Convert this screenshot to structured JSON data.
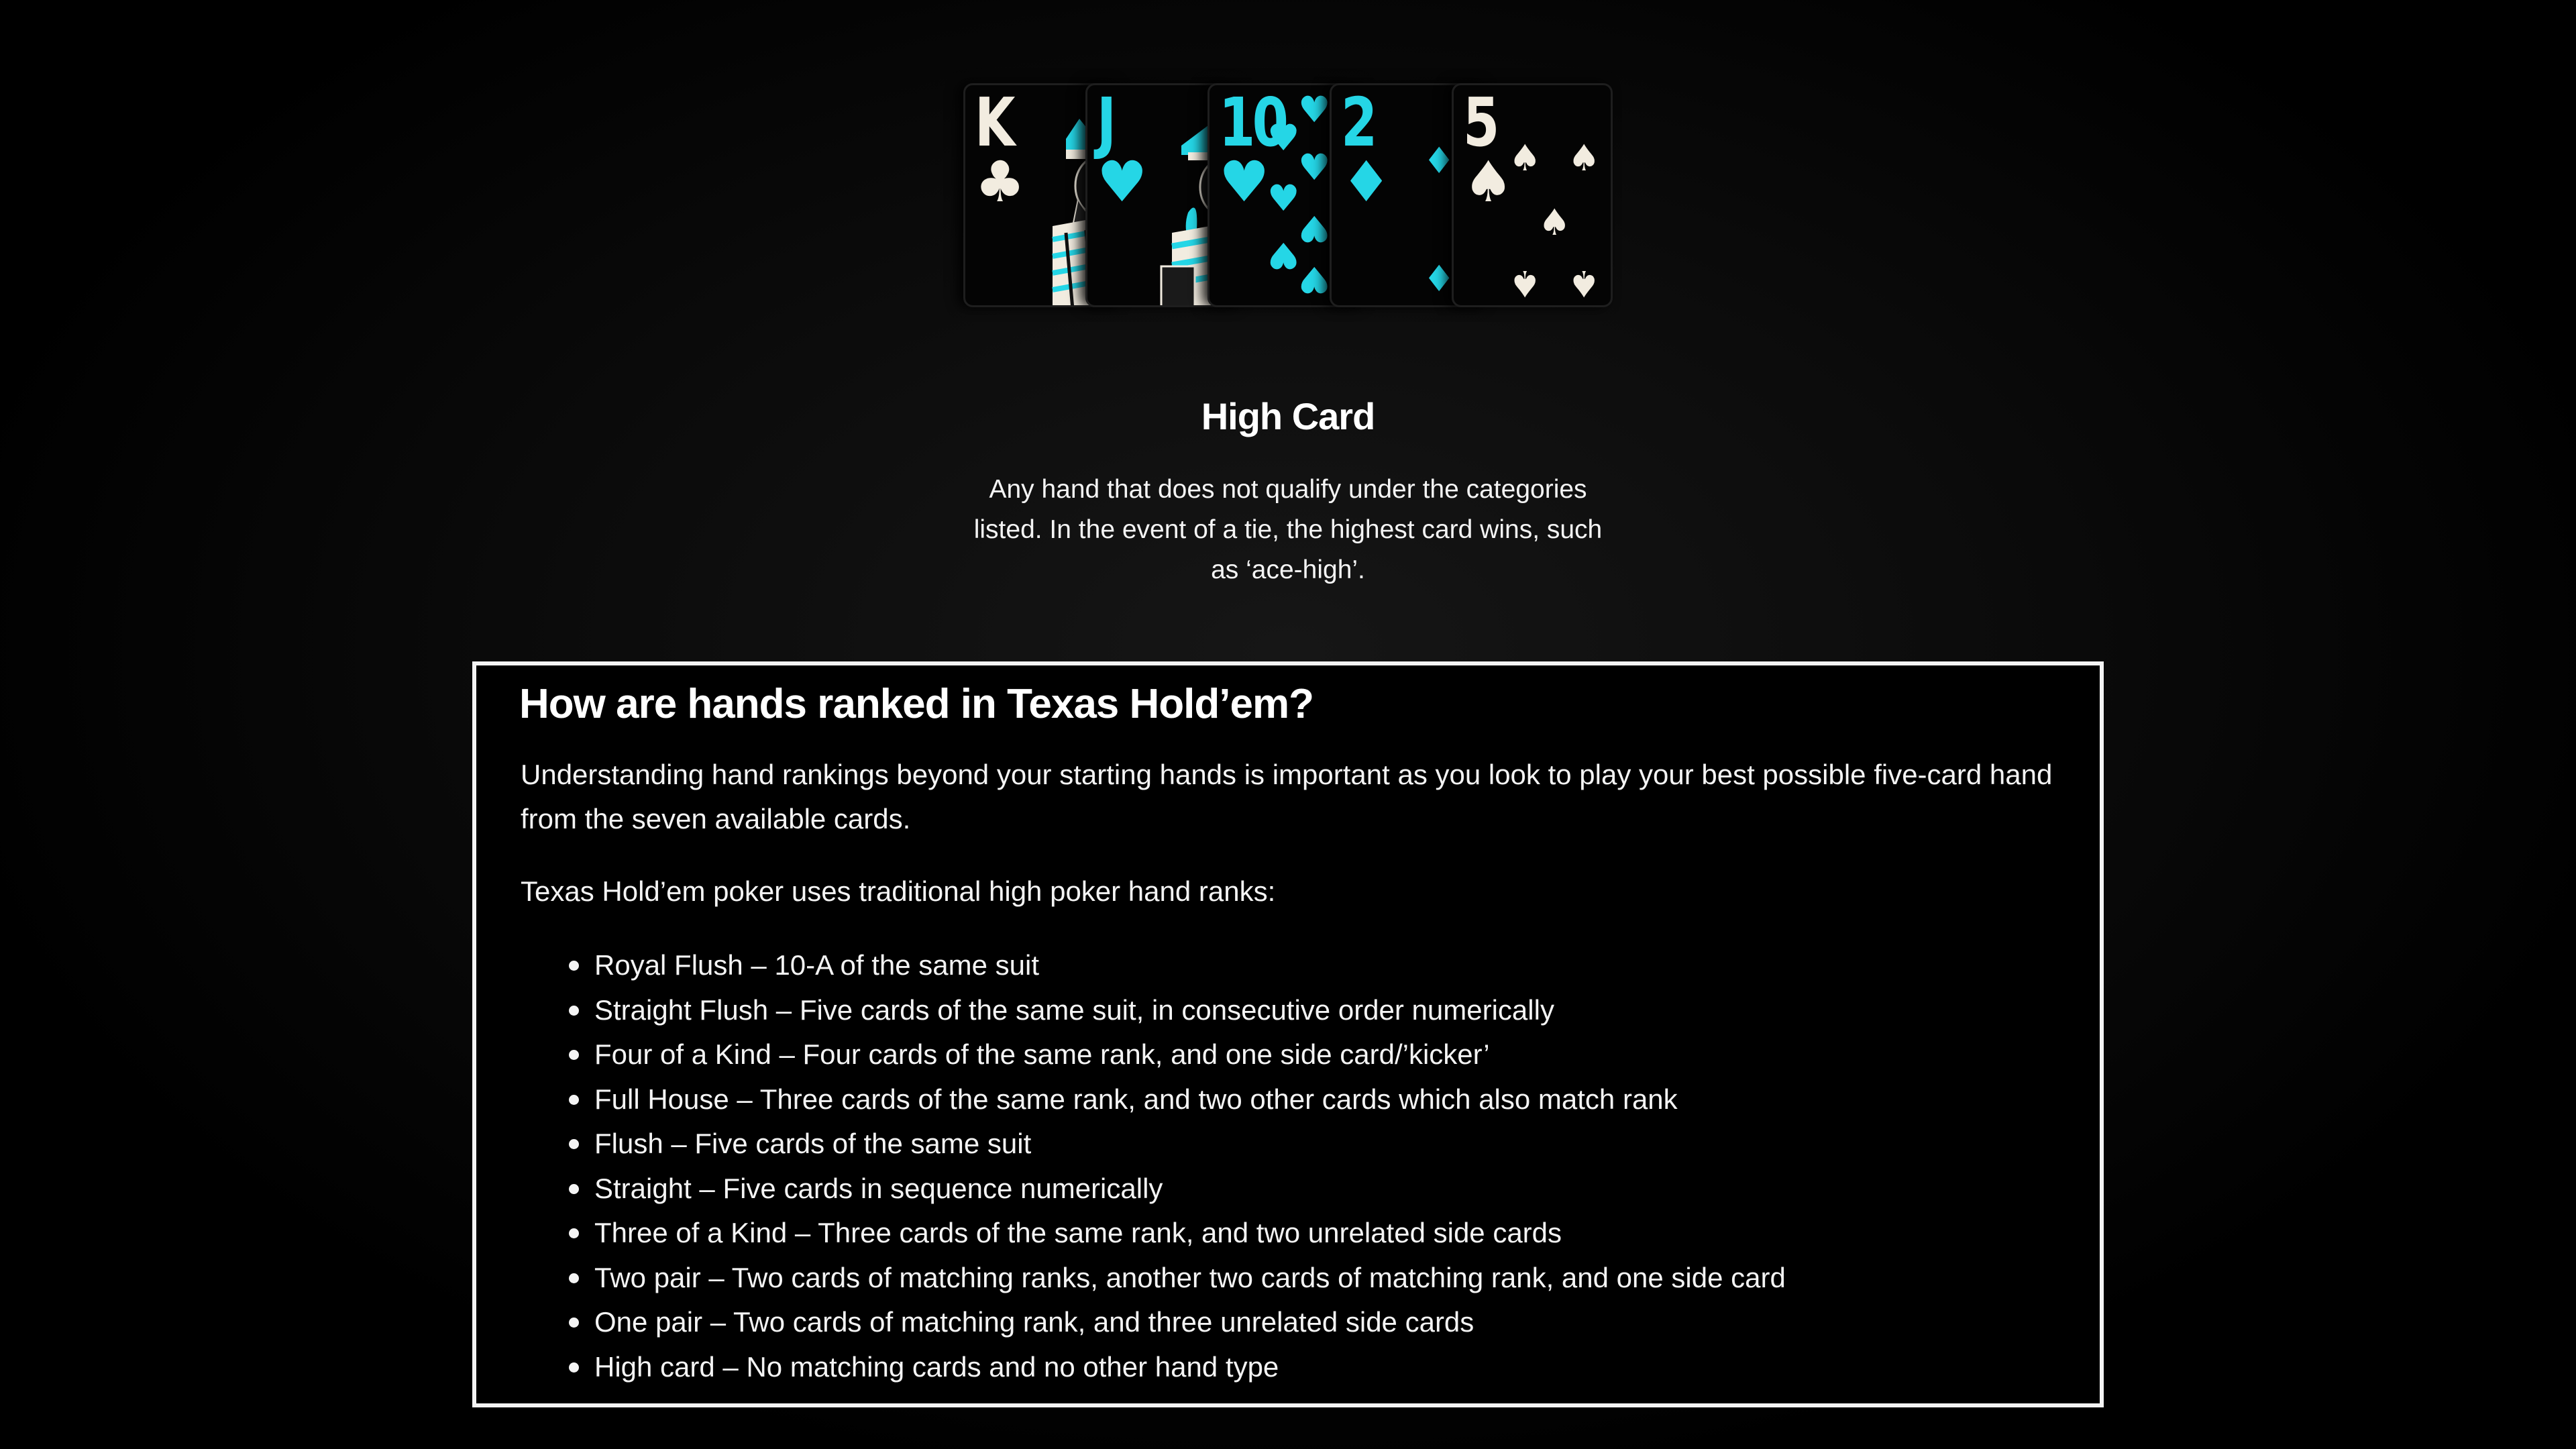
{
  "cards": [
    {
      "rank": "K",
      "suit": "♣",
      "color": "#f2ece0",
      "kind": "face"
    },
    {
      "rank": "J",
      "suit": "♥",
      "color": "#25d6e6",
      "kind": "face"
    },
    {
      "rank": "10",
      "suit": "♥",
      "color": "#25d6e6",
      "kind": "pips"
    },
    {
      "rank": "2",
      "suit": "♦",
      "color": "#25d6e6",
      "kind": "pips"
    },
    {
      "rank": "5",
      "suit": "♠",
      "color": "#f2ece0",
      "kind": "pips"
    }
  ],
  "hand": {
    "title": "High Card",
    "description": "Any hand that does not qualify under the categories listed. In the event of a tie, the highest card wins, such as ‘ace-high’."
  },
  "info": {
    "title": "How are hands ranked in Texas Hold’em?",
    "paragraph1": "Understanding hand rankings beyond your starting hands is important as you look to play your best possible five-card hand from the seven available cards.",
    "paragraph2": "Texas Hold’em poker uses traditional high poker hand ranks:",
    "rankings": [
      "Royal Flush – 10-A of the same suit",
      "Straight Flush – Five cards of the same suit, in consecutive order numerically",
      "Four of a Kind – Four cards of the same rank, and one side card/’kicker’",
      "Full House – Three cards of the same rank, and two other cards which also match rank",
      "Flush – Five cards of the same suit",
      "Straight – Five cards in sequence numerically",
      "Three of a Kind – Three cards of the same rank, and two unrelated side cards",
      "Two pair – Two cards of matching ranks, another two cards of matching rank, and one side card",
      "One pair – Two cards of matching rank, and three unrelated side cards",
      "High card – No matching cards and no other hand type"
    ]
  },
  "colors": {
    "accent": "#25d6e6",
    "card_light": "#f2ece0",
    "background": "#000000"
  }
}
